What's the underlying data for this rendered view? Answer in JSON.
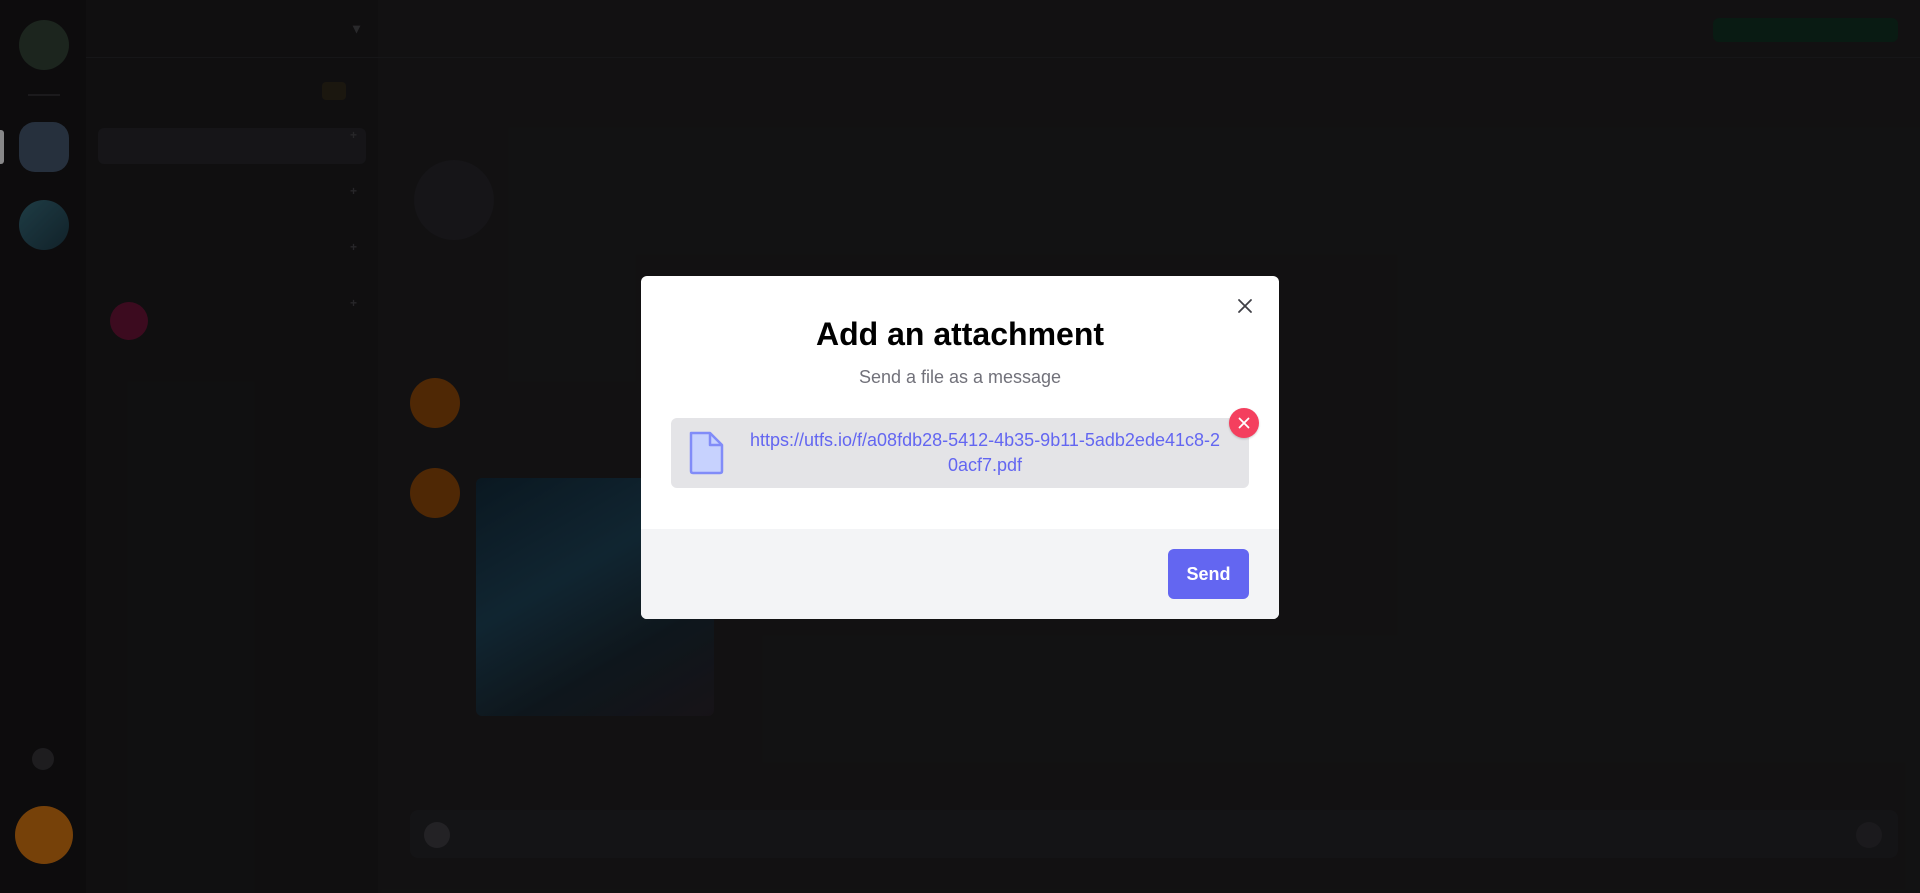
{
  "modal": {
    "title": "Add an attachment",
    "subtitle": "Send a file as a message",
    "file_url": "https://utfs.io/f/a08fdb28-5412-4b35-9b11-5adb2ede41c8-20acf7.pdf",
    "send_label": "Send",
    "file_icon": "file-icon",
    "remove_icon": "x-icon",
    "close_icon": "close-icon"
  },
  "colors": {
    "accent": "#6366f1",
    "danger": "#f43f5e",
    "overlay": "rgba(0,0,0,0.35)"
  }
}
